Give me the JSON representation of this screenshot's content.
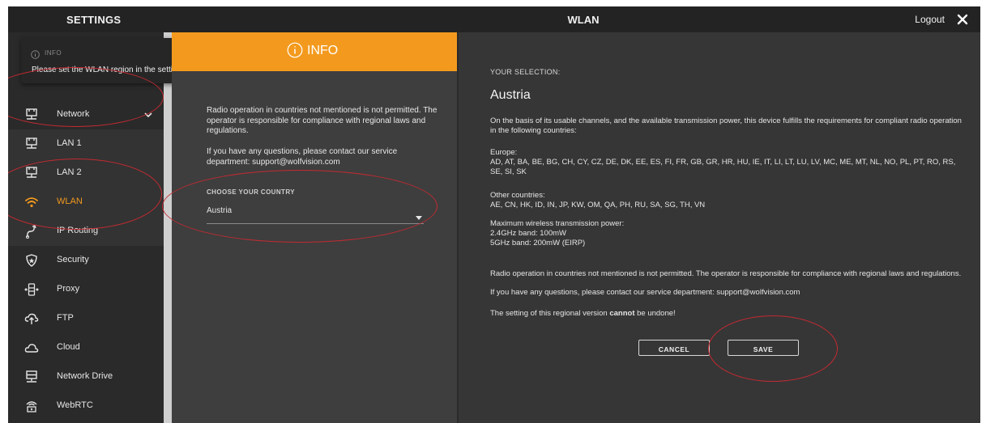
{
  "header": {
    "settings_title": "SETTINGS",
    "page_title": "WLAN",
    "logout_label": "Logout",
    "close_icon": "close-icon"
  },
  "toast": {
    "icon": "info-icon",
    "heading": "INFO",
    "message": "Please set the WLAN region in the settings!"
  },
  "sidebar": {
    "items": [
      {
        "label": "Network",
        "icon": "network-icon"
      },
      {
        "label": "LAN 1",
        "icon": "lan-icon"
      },
      {
        "label": "LAN 2",
        "icon": "lan-icon"
      },
      {
        "label": "WLAN",
        "icon": "wifi-icon"
      },
      {
        "label": "IP Routing",
        "icon": "routing-icon"
      },
      {
        "label": "Security",
        "icon": "shield-icon"
      },
      {
        "label": "Proxy",
        "icon": "proxy-icon"
      },
      {
        "label": "FTP",
        "icon": "cloud-upload-icon"
      },
      {
        "label": "Cloud",
        "icon": "cloud-icon"
      },
      {
        "label": "Network Drive",
        "icon": "network-drive-icon"
      },
      {
        "label": "WebRTC",
        "icon": "webrtc-icon"
      }
    ]
  },
  "info": {
    "title": "INFO",
    "text1": "Radio operation in countries not mentioned is not permitted. The operator is responsible for compliance with regional laws and regulations.",
    "text2": "If you have any questions, please contact our service department: support@wolfvision.com",
    "country_label": "CHOOSE YOUR COUNTRY",
    "country_value": "Austria"
  },
  "selection": {
    "label": "YOUR SELECTION:",
    "country": "Austria",
    "basis": "On the basis of its usable channels, and the available transmission power, this device fulfills the requirements for compliant radio operation in the following countries:",
    "europe_head": "Europe:",
    "europe_list": "AD, AT, BA, BE, BG, CH, CY, CZ, DE, DK, EE, ES, FI, FR, GB, GR, HR, HU, IE, IT, LI, LT, LU, LV, MC, ME, MT, NL, NO, PL, PT, RO, RS, SE, SI, SK",
    "other_head": "Other countries:",
    "other_list": "AE, CN, HK, ID, IN, JP, KW, OM, QA, PH, RU, SA, SG, TH, VN",
    "power_head": "Maximum wireless transmission power:",
    "power_24": "2.4GHz band: 100mW",
    "power_5": "5GHz band: 200mW (EIRP)",
    "notice": "Radio operation in countries not mentioned is not permitted. The operator is responsible for compliance with regional laws and regulations.",
    "contact": "If you have any questions, please contact our service department: support@wolfvision.com",
    "undone_pre": "The setting of this regional version ",
    "undone_bold": "cannot",
    "undone_post": " be undone!",
    "cancel_label": "CANCEL",
    "save_label": "SAVE"
  },
  "colors": {
    "accent": "#f39a1e",
    "highlight_ring": "#c42a32"
  }
}
